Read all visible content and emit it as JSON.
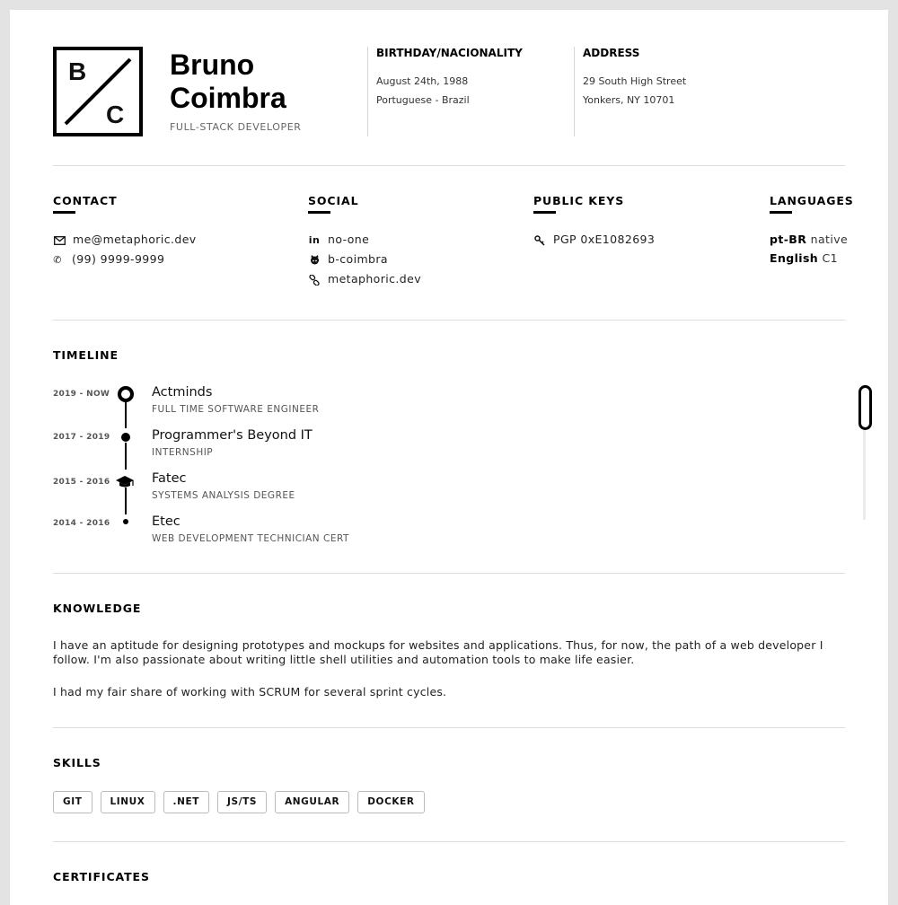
{
  "header": {
    "logo": {
      "top": "B",
      "bottom": "C"
    },
    "first_name": "Bruno",
    "last_name": "Coimbra",
    "role": "FULL-STACK DEVELOPER",
    "birthday": {
      "title": "BIRTHDAY/NACIONALITY",
      "lines": [
        "August 24th, 1988",
        "Portuguese - Brazil"
      ]
    },
    "address": {
      "title": "ADDRESS",
      "lines": [
        "29 South High Street",
        "Yonkers, NY 10701"
      ]
    }
  },
  "contact": {
    "title": "CONTACT",
    "items": [
      {
        "icon": "envelope-icon",
        "text": "me@metaphoric.dev"
      },
      {
        "icon": "phone-icon",
        "text": "(99) 9999-9999"
      }
    ]
  },
  "social": {
    "title": "SOCIAL",
    "items": [
      {
        "icon": "linkedin-icon",
        "text": "no-one"
      },
      {
        "icon": "github-icon",
        "text": "b-coimbra"
      },
      {
        "icon": "link-icon",
        "text": "metaphoric.dev"
      }
    ]
  },
  "public_keys": {
    "title": "PUBLIC KEYS",
    "items": [
      {
        "icon": "key-icon",
        "text": "PGP 0xE1082693"
      }
    ]
  },
  "languages": {
    "title": "LANGUAGES",
    "items": [
      {
        "lang": "pt-BR",
        "level": "native"
      },
      {
        "lang": "English",
        "level": "C1"
      }
    ]
  },
  "timeline": {
    "title": "TIMELINE",
    "entries": [
      {
        "date": "2019 - NOW",
        "title": "Actminds",
        "subtitle": "FULL TIME SOFTWARE ENGINEER",
        "marker": "ring"
      },
      {
        "date": "2017 - 2019",
        "title": "Programmer's Beyond IT",
        "subtitle": "INTERNSHIP",
        "marker": "dot"
      },
      {
        "date": "2015 - 2016",
        "title": "Fatec",
        "subtitle": "SYSTEMS ANALYSIS DEGREE",
        "marker": "graduation-cap-icon"
      },
      {
        "date": "2014 - 2016",
        "title": "Etec",
        "subtitle": "WEB DEVELOPMENT TECHNICIAN CERT",
        "marker": "small-dot"
      }
    ]
  },
  "knowledge": {
    "title": "KNOWLEDGE",
    "paragraphs": [
      "I have an aptitude for designing prototypes and mockups for websites and applications. Thus, for now, the path of a web developer I follow. I'm also passionate about writing little shell utilities and automation tools to make life easier.",
      "I had my fair share of working with SCRUM for several sprint cycles."
    ]
  },
  "skills": {
    "title": "SKILLS",
    "tags": [
      "GIT",
      "LINUX",
      ".NET",
      "JS/TS",
      "ANGULAR",
      "DOCKER"
    ]
  },
  "certificates": {
    "title": "CERTIFICATES"
  }
}
